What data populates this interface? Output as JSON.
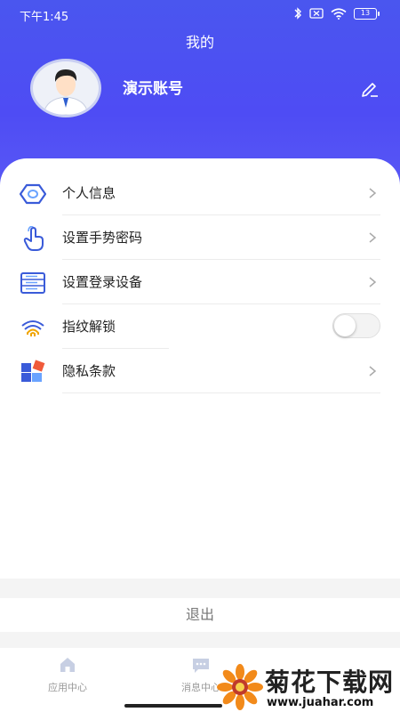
{
  "status_bar": {
    "time": "下午1:45",
    "battery_level": "13"
  },
  "header": {
    "title": "我的",
    "account_name": "演示账号"
  },
  "menu": {
    "items": [
      {
        "label": "个人信息",
        "icon": "eye-hexagon-icon",
        "control": "arrow"
      },
      {
        "label": "设置手势密码",
        "icon": "hand-tap-icon",
        "control": "arrow"
      },
      {
        "label": "设置登录设备",
        "icon": "server-list-icon",
        "control": "arrow"
      },
      {
        "label": "指纹解锁",
        "icon": "fingerprint-icon",
        "control": "toggle",
        "enabled": false
      },
      {
        "label": "隐私条款",
        "icon": "blocks-icon",
        "control": "arrow"
      }
    ]
  },
  "logout_label": "退出",
  "tabbar": {
    "tabs": [
      {
        "label": "应用中心",
        "icon": "home-icon"
      },
      {
        "label": "消息中心",
        "icon": "message-icon"
      }
    ]
  },
  "watermark": {
    "title": "菊花下载网",
    "url": "www.juahar.com"
  },
  "colors": {
    "header_primary": "#4e4cf4",
    "accent_icon": "#3a5bd9",
    "text_primary": "#222222",
    "text_muted": "#777777"
  }
}
